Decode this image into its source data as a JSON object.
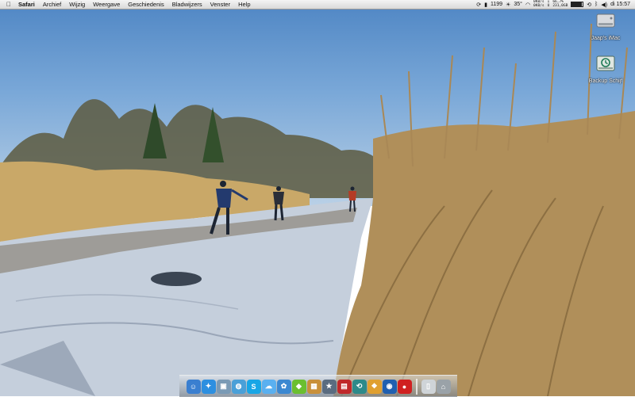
{
  "menubar": {
    "app_name": "Safari",
    "items": [
      "Archief",
      "Wijzig",
      "Weergave",
      "Geschiedenis",
      "Bladwijzers",
      "Venster",
      "Help"
    ],
    "status": {
      "signal_value": "1199",
      "temperature": "35°",
      "clock": "di 15:57",
      "stats_left": [
        "0KB/s",
        "0KB/s",
        "0KB/s"
      ],
      "stats_mid": [
        "I",
        "U",
        "P"
      ],
      "stats_right": [
        "66,7%",
        "231,0GB",
        "231,0GB"
      ],
      "battery_level": 0.9
    }
  },
  "desktop": {
    "icons": [
      {
        "label": "Jaap's iMac",
        "icon": "hard-drive-icon"
      },
      {
        "label": "Backup Schijf",
        "icon": "time-machine-drive-icon"
      }
    ]
  },
  "dock": {
    "apps": [
      {
        "icon": "finder-icon",
        "color": "#3a7fd0",
        "glyph": "☺"
      },
      {
        "icon": "safari-icon",
        "color": "#2d8fe0",
        "glyph": "✦"
      },
      {
        "icon": "preview-icon",
        "color": "#7a9ab5",
        "glyph": "▣"
      },
      {
        "icon": "network-icon",
        "color": "#4aa0d8",
        "glyph": "◍"
      },
      {
        "icon": "skype-icon",
        "color": "#18a6e6",
        "glyph": "S"
      },
      {
        "icon": "ichat-icon",
        "color": "#5ab0f0",
        "glyph": "☁"
      },
      {
        "icon": "iphoto-icon",
        "color": "#3b88d1",
        "glyph": "✿"
      },
      {
        "icon": "app-green-icon",
        "color": "#6bbf30",
        "glyph": "◆"
      },
      {
        "icon": "photo-app-icon",
        "color": "#c9903a",
        "glyph": "▦"
      },
      {
        "icon": "imovie-icon",
        "color": "#5a6c80",
        "glyph": "★"
      },
      {
        "icon": "photobooth-icon",
        "color": "#c0282a",
        "glyph": "▤"
      },
      {
        "icon": "time-machine-icon",
        "color": "#2d8a8a",
        "glyph": "⟲"
      },
      {
        "icon": "sync-icon",
        "color": "#e0a030",
        "glyph": "❖"
      },
      {
        "icon": "blue-globe-icon",
        "color": "#2060b0",
        "glyph": "◉"
      },
      {
        "icon": "record-icon",
        "color": "#d02020",
        "glyph": "●"
      }
    ],
    "right": [
      {
        "icon": "documents-stack-icon",
        "color": "#cfd4d8",
        "glyph": "▯"
      },
      {
        "icon": "trash-icon",
        "color": "#9aa2a8",
        "glyph": "⌂"
      }
    ]
  }
}
